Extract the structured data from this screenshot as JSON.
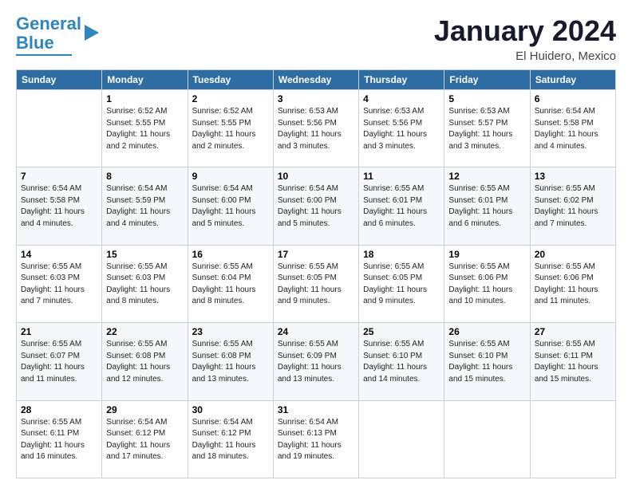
{
  "header": {
    "logo_line1": "General",
    "logo_line2": "Blue",
    "month_title": "January 2024",
    "location": "El Huidero, Mexico"
  },
  "weekdays": [
    "Sunday",
    "Monday",
    "Tuesday",
    "Wednesday",
    "Thursday",
    "Friday",
    "Saturday"
  ],
  "weeks": [
    [
      {
        "day": "",
        "info": ""
      },
      {
        "day": "1",
        "info": "Sunrise: 6:52 AM\nSunset: 5:55 PM\nDaylight: 11 hours\nand 2 minutes."
      },
      {
        "day": "2",
        "info": "Sunrise: 6:52 AM\nSunset: 5:55 PM\nDaylight: 11 hours\nand 2 minutes."
      },
      {
        "day": "3",
        "info": "Sunrise: 6:53 AM\nSunset: 5:56 PM\nDaylight: 11 hours\nand 3 minutes."
      },
      {
        "day": "4",
        "info": "Sunrise: 6:53 AM\nSunset: 5:56 PM\nDaylight: 11 hours\nand 3 minutes."
      },
      {
        "day": "5",
        "info": "Sunrise: 6:53 AM\nSunset: 5:57 PM\nDaylight: 11 hours\nand 3 minutes."
      },
      {
        "day": "6",
        "info": "Sunrise: 6:54 AM\nSunset: 5:58 PM\nDaylight: 11 hours\nand 4 minutes."
      }
    ],
    [
      {
        "day": "7",
        "info": "Sunrise: 6:54 AM\nSunset: 5:58 PM\nDaylight: 11 hours\nand 4 minutes."
      },
      {
        "day": "8",
        "info": "Sunrise: 6:54 AM\nSunset: 5:59 PM\nDaylight: 11 hours\nand 4 minutes."
      },
      {
        "day": "9",
        "info": "Sunrise: 6:54 AM\nSunset: 6:00 PM\nDaylight: 11 hours\nand 5 minutes."
      },
      {
        "day": "10",
        "info": "Sunrise: 6:54 AM\nSunset: 6:00 PM\nDaylight: 11 hours\nand 5 minutes."
      },
      {
        "day": "11",
        "info": "Sunrise: 6:55 AM\nSunset: 6:01 PM\nDaylight: 11 hours\nand 6 minutes."
      },
      {
        "day": "12",
        "info": "Sunrise: 6:55 AM\nSunset: 6:01 PM\nDaylight: 11 hours\nand 6 minutes."
      },
      {
        "day": "13",
        "info": "Sunrise: 6:55 AM\nSunset: 6:02 PM\nDaylight: 11 hours\nand 7 minutes."
      }
    ],
    [
      {
        "day": "14",
        "info": "Sunrise: 6:55 AM\nSunset: 6:03 PM\nDaylight: 11 hours\nand 7 minutes."
      },
      {
        "day": "15",
        "info": "Sunrise: 6:55 AM\nSunset: 6:03 PM\nDaylight: 11 hours\nand 8 minutes."
      },
      {
        "day": "16",
        "info": "Sunrise: 6:55 AM\nSunset: 6:04 PM\nDaylight: 11 hours\nand 8 minutes."
      },
      {
        "day": "17",
        "info": "Sunrise: 6:55 AM\nSunset: 6:05 PM\nDaylight: 11 hours\nand 9 minutes."
      },
      {
        "day": "18",
        "info": "Sunrise: 6:55 AM\nSunset: 6:05 PM\nDaylight: 11 hours\nand 9 minutes."
      },
      {
        "day": "19",
        "info": "Sunrise: 6:55 AM\nSunset: 6:06 PM\nDaylight: 11 hours\nand 10 minutes."
      },
      {
        "day": "20",
        "info": "Sunrise: 6:55 AM\nSunset: 6:06 PM\nDaylight: 11 hours\nand 11 minutes."
      }
    ],
    [
      {
        "day": "21",
        "info": "Sunrise: 6:55 AM\nSunset: 6:07 PM\nDaylight: 11 hours\nand 11 minutes."
      },
      {
        "day": "22",
        "info": "Sunrise: 6:55 AM\nSunset: 6:08 PM\nDaylight: 11 hours\nand 12 minutes."
      },
      {
        "day": "23",
        "info": "Sunrise: 6:55 AM\nSunset: 6:08 PM\nDaylight: 11 hours\nand 13 minutes."
      },
      {
        "day": "24",
        "info": "Sunrise: 6:55 AM\nSunset: 6:09 PM\nDaylight: 11 hours\nand 13 minutes."
      },
      {
        "day": "25",
        "info": "Sunrise: 6:55 AM\nSunset: 6:10 PM\nDaylight: 11 hours\nand 14 minutes."
      },
      {
        "day": "26",
        "info": "Sunrise: 6:55 AM\nSunset: 6:10 PM\nDaylight: 11 hours\nand 15 minutes."
      },
      {
        "day": "27",
        "info": "Sunrise: 6:55 AM\nSunset: 6:11 PM\nDaylight: 11 hours\nand 15 minutes."
      }
    ],
    [
      {
        "day": "28",
        "info": "Sunrise: 6:55 AM\nSunset: 6:11 PM\nDaylight: 11 hours\nand 16 minutes."
      },
      {
        "day": "29",
        "info": "Sunrise: 6:54 AM\nSunset: 6:12 PM\nDaylight: 11 hours\nand 17 minutes."
      },
      {
        "day": "30",
        "info": "Sunrise: 6:54 AM\nSunset: 6:12 PM\nDaylight: 11 hours\nand 18 minutes."
      },
      {
        "day": "31",
        "info": "Sunrise: 6:54 AM\nSunset: 6:13 PM\nDaylight: 11 hours\nand 19 minutes."
      },
      {
        "day": "",
        "info": ""
      },
      {
        "day": "",
        "info": ""
      },
      {
        "day": "",
        "info": ""
      }
    ]
  ]
}
